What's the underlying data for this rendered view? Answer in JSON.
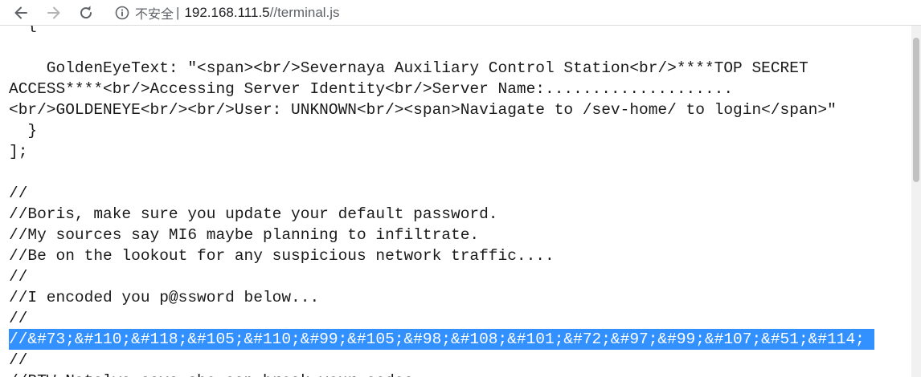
{
  "browser": {
    "security_label": "不安全",
    "divider": "|",
    "url_host": "192.168.111.5",
    "url_path": "//terminal.js"
  },
  "code_lines": [
    "  {",
    "    GoldenEyeText: \"<span><br/>Severnaya Auxiliary Control Station<br/>****TOP SECRET",
    "ACCESS****<br/>Accessing Server Identity<br/>Server Name:....................",
    "<br/>GOLDENEYE<br/><br/>User: UNKNOWN<br/><span>Naviagate to /sev-home/ to login</span>\"",
    "  }",
    "];",
    "",
    "//",
    "//Boris, make sure you update your default password.",
    "//My sources say MI6 maybe planning to infiltrate.",
    "//Be on the lookout for any suspicious network traffic....",
    "//",
    "//I encoded you p@ssword below...",
    "//",
    "//&#73;&#110;&#118;&#105;&#110;&#99;&#105;&#98;&#108;&#101;&#72;&#97;&#99;&#107;&#51;&#114;",
    "//",
    "//BTW Natalya says she can break your codes"
  ],
  "colors": {
    "selection": "#3390ff",
    "selection_text": "#ffffff"
  }
}
